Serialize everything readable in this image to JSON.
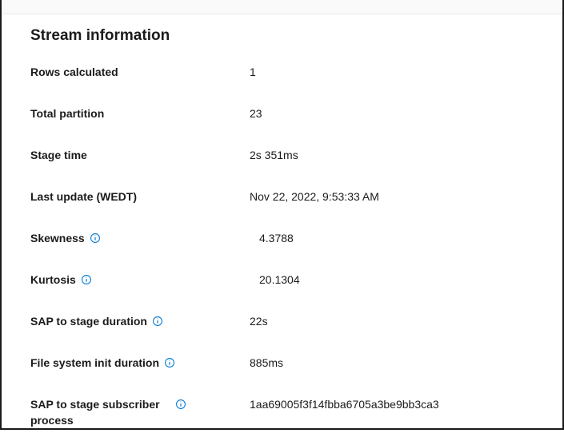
{
  "panel": {
    "title": "Stream information"
  },
  "rows": {
    "rows_calculated": {
      "label": "Rows calculated",
      "value": "1"
    },
    "total_partition": {
      "label": "Total partition",
      "value": "23"
    },
    "stage_time": {
      "label": "Stage time",
      "value": "2s 351ms"
    },
    "last_update": {
      "label": "Last update (WEDT)",
      "value": "Nov 22, 2022, 9:53:33 AM"
    },
    "skewness": {
      "label": "Skewness",
      "value": "4.3788"
    },
    "kurtosis": {
      "label": "Kurtosis",
      "value": "20.1304"
    },
    "sap_to_stage_duration": {
      "label": "SAP to stage duration",
      "value": "22s"
    },
    "file_system_init_duration": {
      "label": "File system init duration",
      "value": "885ms"
    },
    "sap_to_stage_subscriber_process": {
      "label": "SAP to stage subscriber process",
      "value": "1aa69005f3f14fbba6705a3be9bb3ca3"
    }
  }
}
